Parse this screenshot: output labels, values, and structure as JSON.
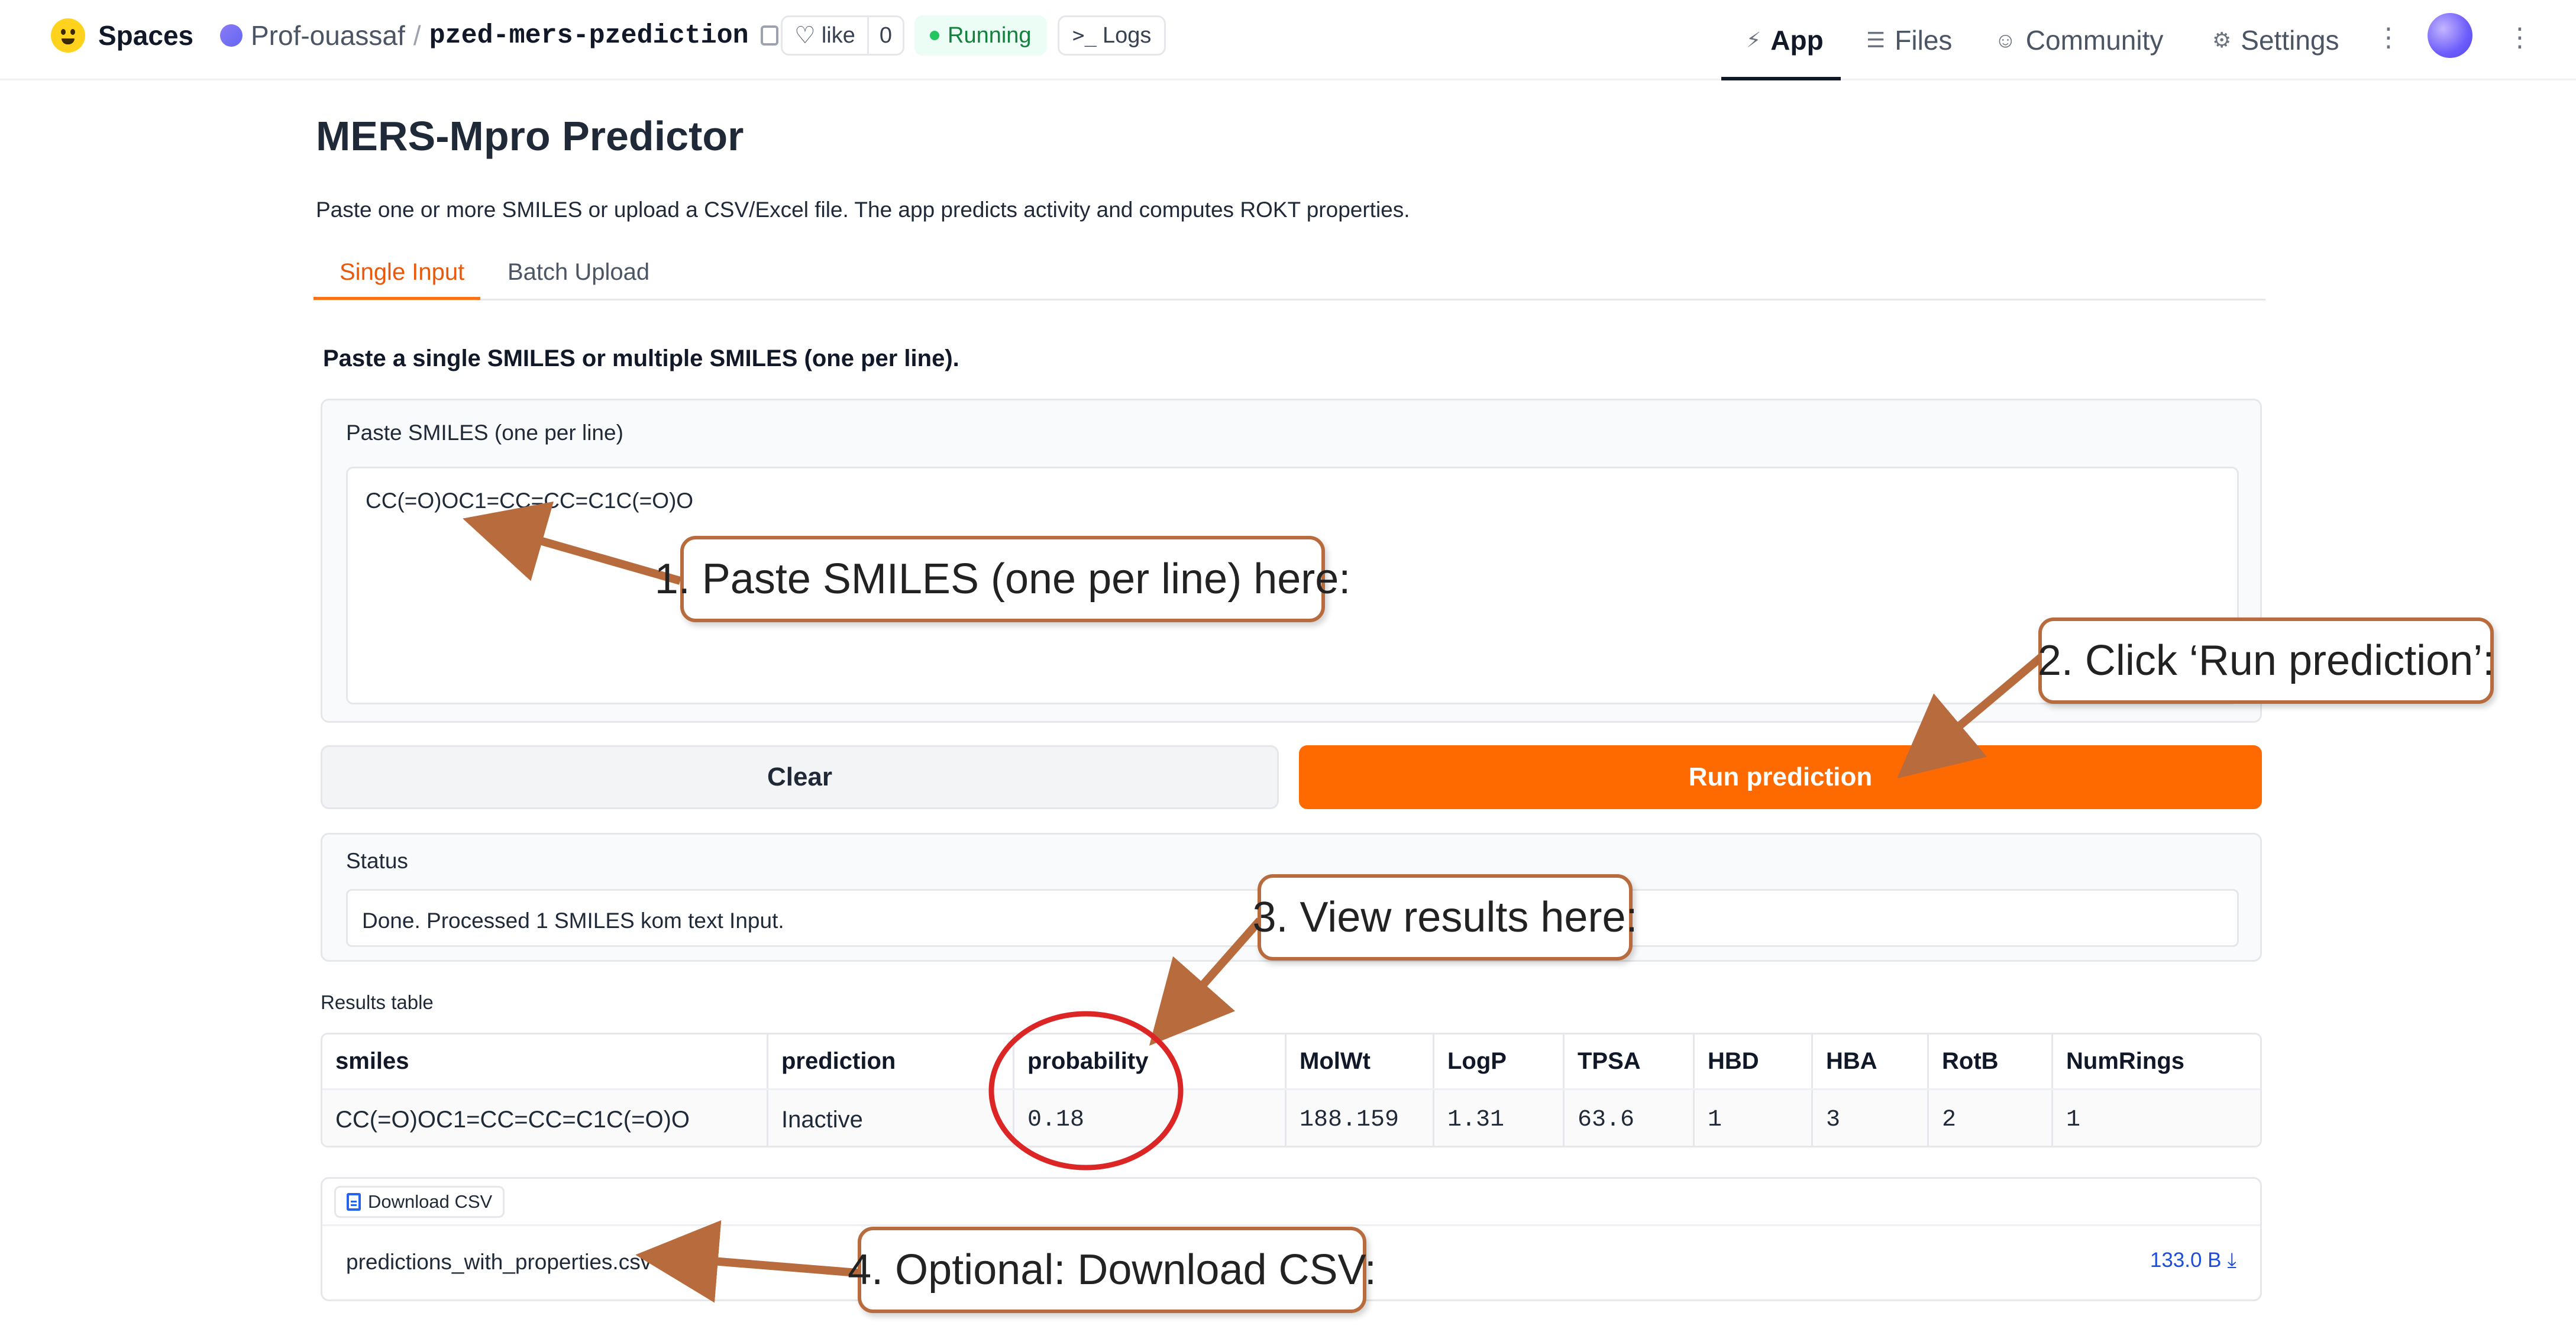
{
  "topbar": {
    "brand": "Spaces",
    "repo_owner": "Prof-ouassaf",
    "repo_slash": "/",
    "repo_name": "pzed-mers-pzediction",
    "like_label": "like",
    "like_count": "0",
    "status": "Running",
    "logs_label": "Logs",
    "nav": {
      "app": "App",
      "files": "Files",
      "community": "Community",
      "settings": "Settings"
    },
    "icons": {
      "brand": "huggingface-icon",
      "copy": "copy-icon",
      "heart": "heart-icon",
      "logs": "terminal-icon",
      "app": "app-icon",
      "files": "files-icon",
      "community": "community-icon",
      "settings": "gear-icon",
      "more": "kebab-icon"
    }
  },
  "page": {
    "title": "MERS-Mpro Predictor",
    "description": "Paste one or more SMILES or upload a CSV/Excel file. The app predicts activity and computes ROKT properties.",
    "tabs": [
      "Single Input",
      "Batch Upload"
    ],
    "active_tab": "Single Input",
    "subheading": "Paste a single SMILES or multiple SMILES (one per line).",
    "input_label": "Paste SMILES (one per line)",
    "input_value": "CC(=O)OC1=CC=CC=C1C(=O)O",
    "clear_button": "Clear",
    "run_button": "Run prediction",
    "status_label": "Status",
    "status_text": "Done. Processed 1 SMILES kom text Input.",
    "results_label": "Results table",
    "results": {
      "columns": [
        "smiles",
        "prediction",
        "probability",
        "MolWt",
        "LogP",
        "TPSA",
        "HBD",
        "HBA",
        "RotB",
        "NumRings"
      ],
      "rows": [
        [
          "CC(=O)OC1=CC=CC=C1C(=O)O",
          "Inactive",
          "0.18",
          "188.159",
          "1.31",
          "63.6",
          "1",
          "3",
          "2",
          "1"
        ]
      ]
    },
    "download_label": "Download CSV",
    "download_file": "predictions_with_properties.csv",
    "download_size": "133.0 B"
  },
  "callouts": {
    "step1": "1. Paste SMILES (one per line) here:",
    "step2": "2. Click ‘Run prediction’:",
    "step3": "3. View results here:",
    "step4": "4. Optional: Download CSV:"
  },
  "colors": {
    "accent_orange": "#ff6a00",
    "callout_border": "#b86b3c",
    "highlight_circle": "#dc2626",
    "running_green": "#15803d"
  }
}
